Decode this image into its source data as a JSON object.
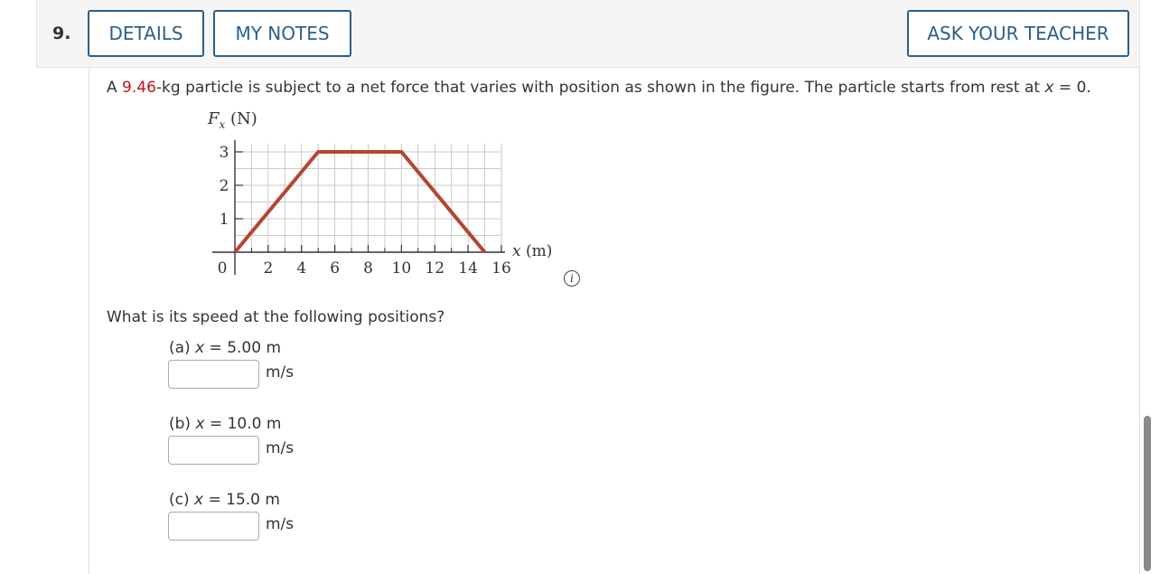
{
  "question": {
    "number": "9.",
    "buttons": {
      "details": "DETAILS",
      "my_notes": "MY NOTES",
      "ask_teacher": "ASK YOUR TEACHER"
    },
    "problem": {
      "prefix": "A ",
      "mass": "9.46",
      "text": "-kg particle is subject to a net force that varies with position as shown in the figure. The particle starts from rest at ",
      "var": "x",
      "suffix": " = 0."
    },
    "prompt": "What is its speed at the following positions?",
    "parts": [
      {
        "label": "(a) ",
        "var": "x",
        "eq": " = 5.00 m",
        "unit": "m/s",
        "value": ""
      },
      {
        "label": "(b) ",
        "var": "x",
        "eq": " = 10.0 m",
        "unit": "m/s",
        "value": ""
      },
      {
        "label": "(c) ",
        "var": "x",
        "eq": " = 15.0 m",
        "unit": "m/s",
        "value": ""
      }
    ],
    "info_icon": "info-icon"
  },
  "chart_data": {
    "type": "line",
    "ylabel_main": "F",
    "ylabel_sub": "x",
    "ylabel_unit": " (N)",
    "xlabel": "x (m)",
    "x_ticks": [
      "0",
      "2",
      "4",
      "6",
      "8",
      "10",
      "12",
      "14",
      "16"
    ],
    "y_ticks": [
      "1",
      "2",
      "3"
    ],
    "xlim": [
      0,
      16
    ],
    "ylim": [
      0,
      3
    ],
    "grid": true,
    "line_color": "#b5452f",
    "series": [
      {
        "x": [
          0,
          5,
          10,
          15
        ],
        "y": [
          0,
          3,
          3,
          0
        ]
      }
    ]
  }
}
